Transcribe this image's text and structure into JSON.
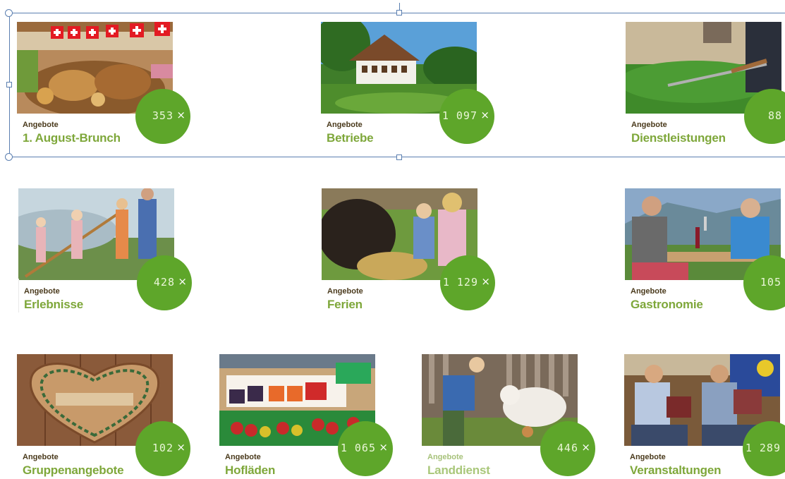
{
  "cards": [
    {
      "kicker": "Angebote",
      "title": "1. August-Brunch",
      "count": "353",
      "close": "×"
    },
    {
      "kicker": "Angebote",
      "title": "Betriebe",
      "count": "1 097",
      "close": "×"
    },
    {
      "kicker": "Angebote",
      "title": "Dienstleistungen",
      "count": "88",
      "close": "×"
    },
    {
      "kicker": "Angebote",
      "title": "Erlebnisse",
      "count": "428",
      "close": "×"
    },
    {
      "kicker": "Angebote",
      "title": "Ferien",
      "count": "1 129",
      "close": "×"
    },
    {
      "kicker": "Angebote",
      "title": "Gastronomie",
      "count": "105",
      "close": "×"
    },
    {
      "kicker": "Angebote",
      "title": "Gruppenangebote",
      "count": "102",
      "close": "×"
    },
    {
      "kicker": "Angebote",
      "title": "Hofläden",
      "count": "1 065",
      "close": "×"
    },
    {
      "kicker": "Angebote",
      "title": "Landdienst",
      "count": "446",
      "close": "×"
    },
    {
      "kicker": "Angebote",
      "title": "Veranstaltungen",
      "count": "1 289",
      "close": "×"
    }
  ],
  "colors": {
    "accent_green": "#5ea62a",
    "title_green": "#7ea73a",
    "kicker_brown": "#4a3a1c",
    "selection_blue": "#5b7fb0"
  }
}
